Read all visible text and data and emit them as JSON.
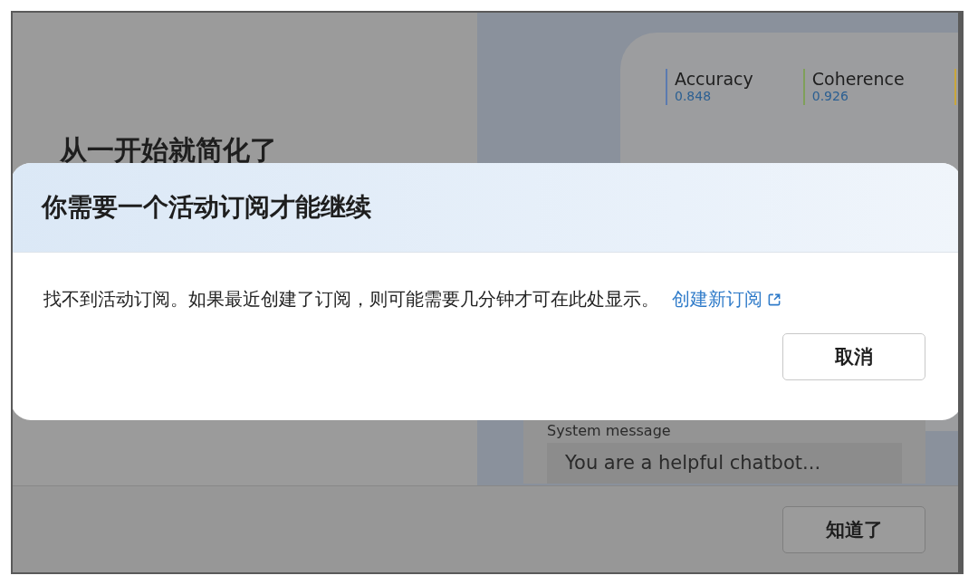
{
  "background": {
    "heading": "从一开始就简化了",
    "metrics": [
      {
        "label": "Accuracy",
        "value": "0.848",
        "color": "#5b7bb0"
      },
      {
        "label": "Coherence",
        "value": "0.926",
        "color": "#7fa05a"
      },
      {
        "color": "#c9a63c"
      }
    ],
    "system_message": {
      "label": "System message",
      "value": "You are a helpful chatbot..."
    },
    "footer_button": "知道了"
  },
  "dialog": {
    "title": "你需要一个活动订阅才能继续",
    "message": "找不到活动订阅。如果最近创建了订阅，则可能需要几分钟才可在此处显示。",
    "link": "创建新订阅",
    "buttons": [
      "取消"
    ]
  }
}
